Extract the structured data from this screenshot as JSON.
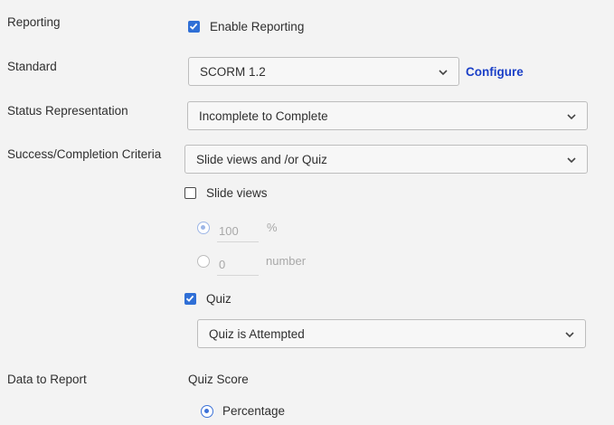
{
  "rows": {
    "reporting": "Reporting",
    "standard": "Standard",
    "status_representation": "Status Representation",
    "success_criteria": "Success/Completion Criteria",
    "data_to_report": "Data to Report"
  },
  "enable_reporting": {
    "label": "Enable Reporting",
    "checked": true
  },
  "standard_select": {
    "value": "SCORM 1.2"
  },
  "configure_link": "Configure",
  "status_select": {
    "value": "Incomplete to Complete"
  },
  "criteria_select": {
    "value": "Slide views and /or Quiz"
  },
  "slide_views": {
    "label": "Slide views",
    "checked": false,
    "percent_value": "100",
    "percent_unit": "%",
    "number_value": "0",
    "number_unit": "number"
  },
  "quiz": {
    "label": "Quiz",
    "checked": true,
    "select_value": "Quiz is Attempted"
  },
  "data_report": {
    "quiz_score": "Quiz Score",
    "percentage": "Percentage"
  },
  "colors": {
    "accent": "#2f6fd6",
    "link": "#1a3fc7"
  }
}
